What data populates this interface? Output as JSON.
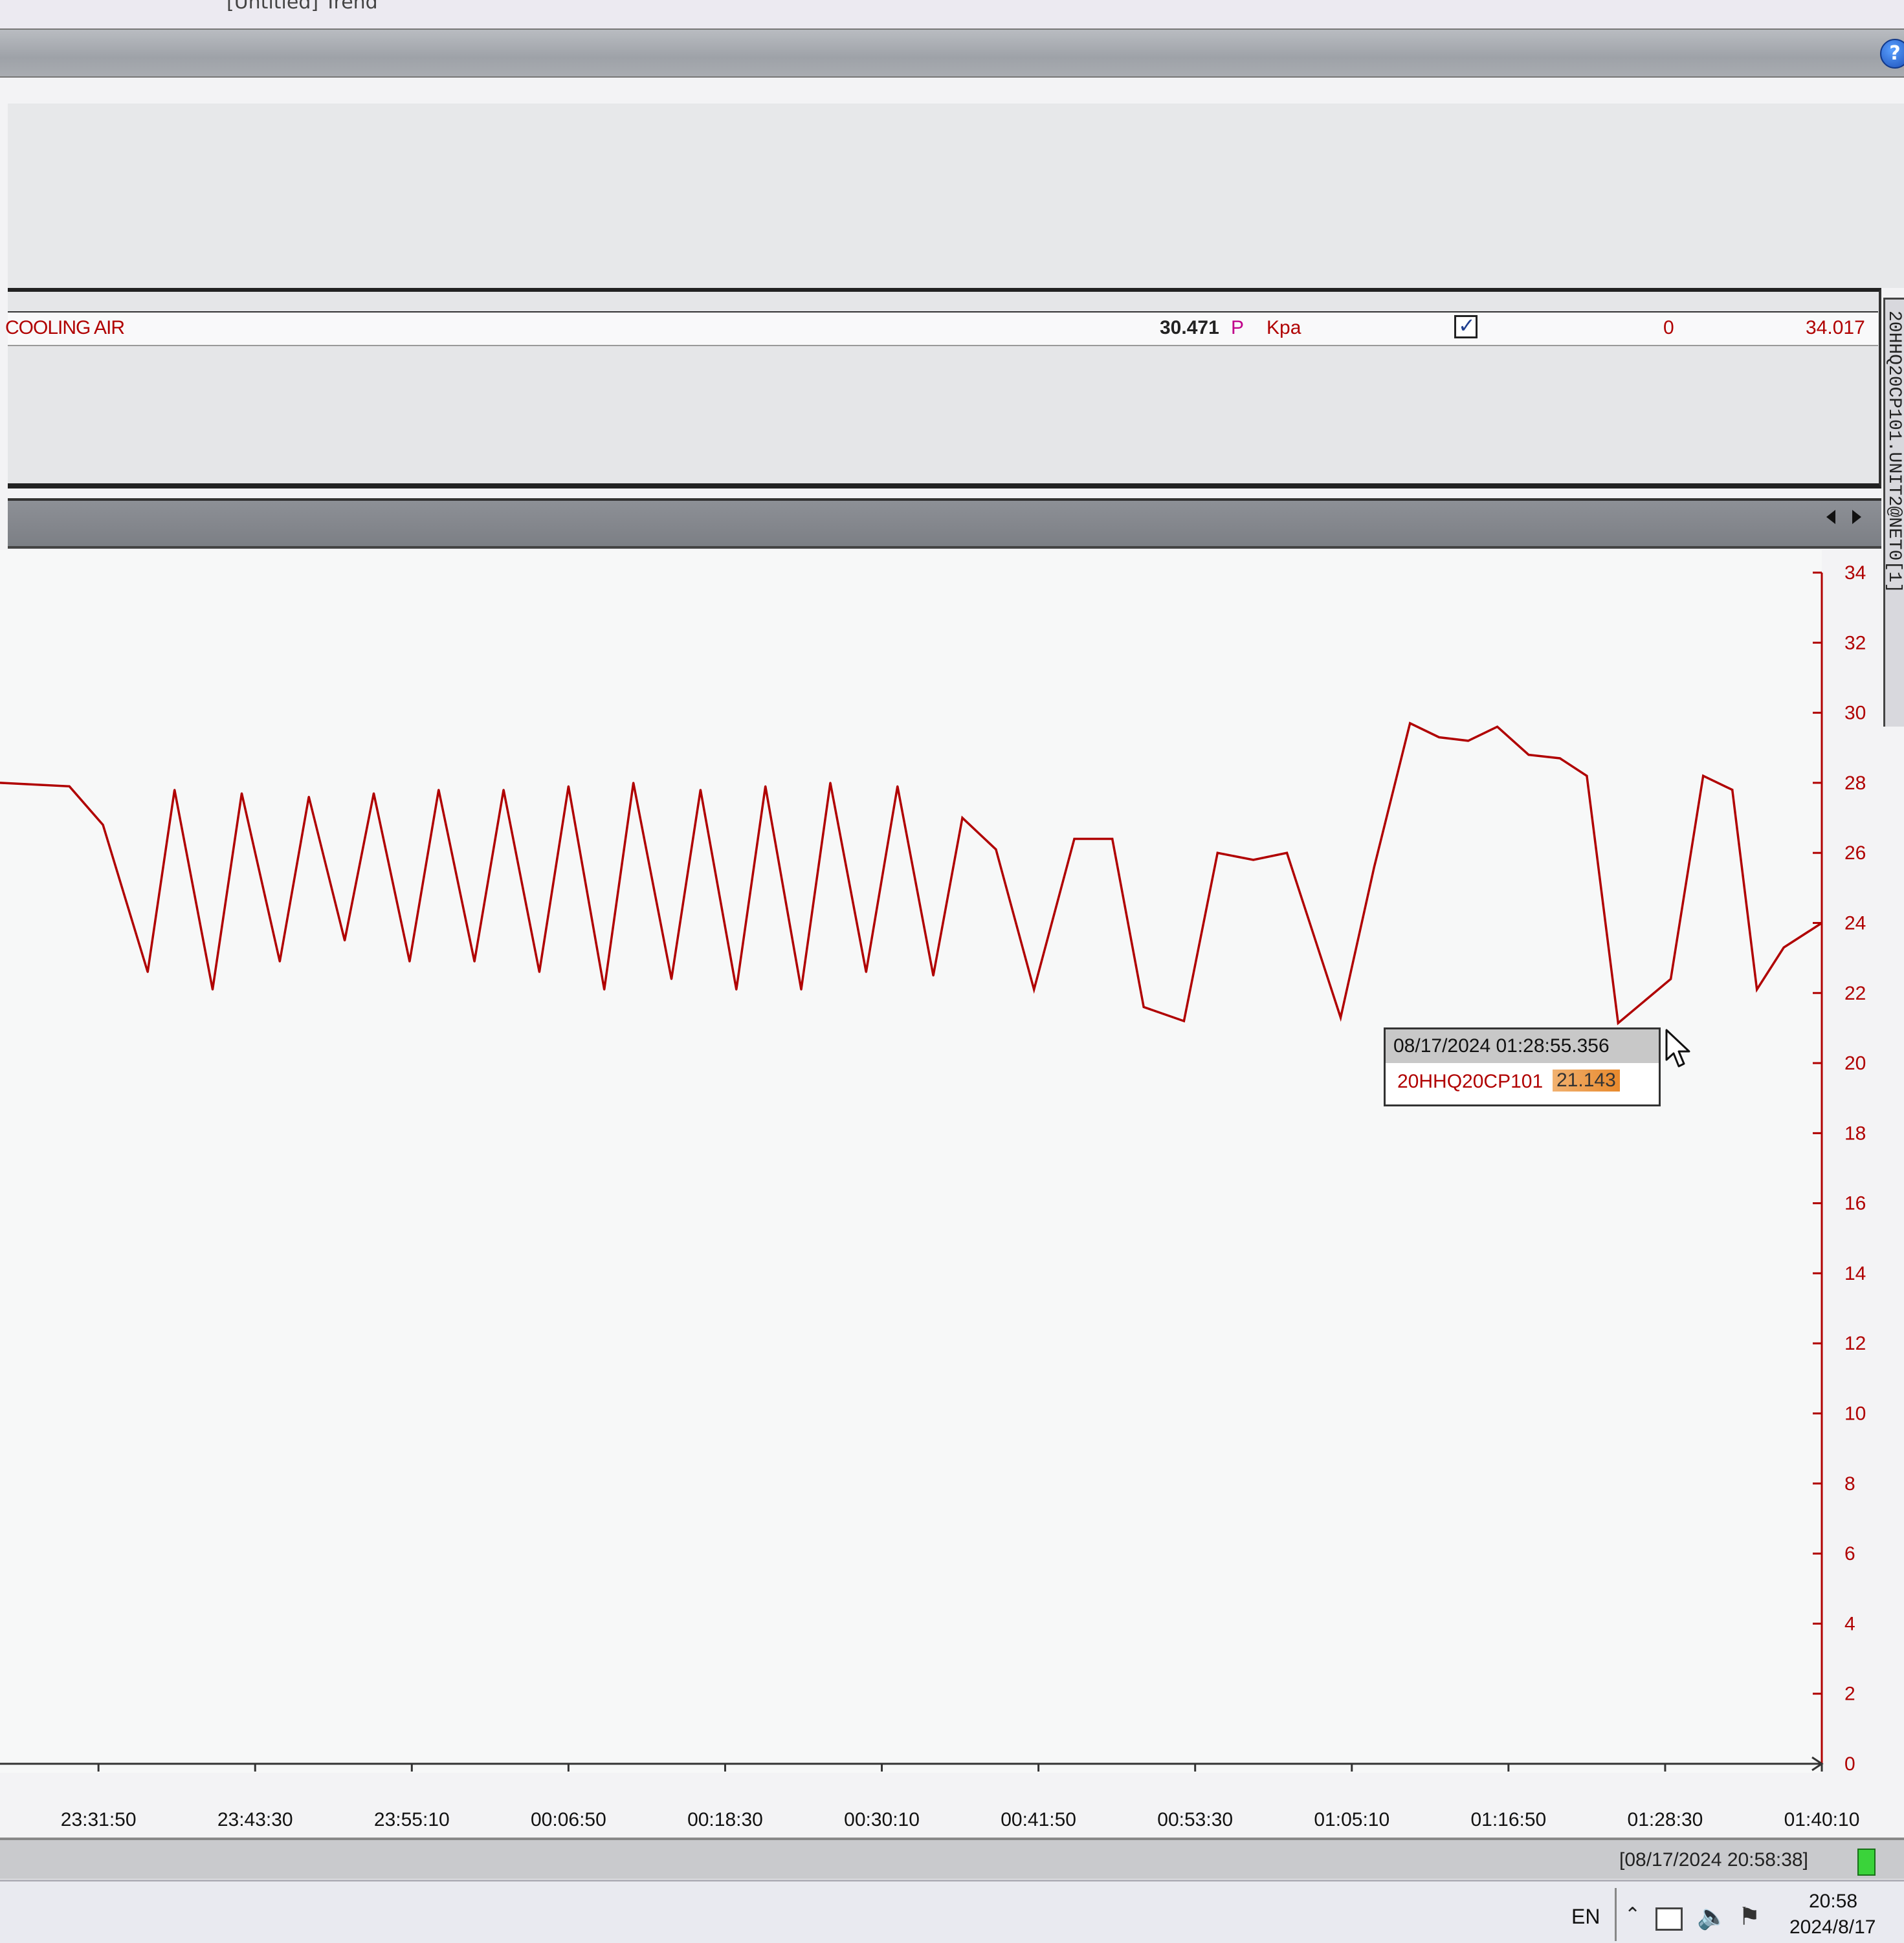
{
  "window": {
    "title": "[Untitled] Trend"
  },
  "series_row": {
    "name": "COOLING AIR",
    "current_value": "30.471",
    "quality": "P",
    "unit": "Kpa",
    "visible_checked": true,
    "min": "0",
    "max": "34.017"
  },
  "vertical_tab": {
    "label": "20HHQ20CP101.UNIT2@NET0[1]"
  },
  "tooltip": {
    "timestamp": "08/17/2024 01:28:55.356",
    "tag": "20HHQ20CP101",
    "value": "21.143"
  },
  "status_bar": {
    "timestamp": "[08/17/2024 20:58:38]"
  },
  "taskbar": {
    "language": "EN",
    "clock_time": "20:58",
    "clock_date": "2024/8/17"
  },
  "colors": {
    "series_line": "#b00000",
    "axis": "#b00000"
  },
  "chart_data": {
    "type": "line",
    "x_tick_labels": [
      "23:31:50",
      "23:43:30",
      "23:55:10",
      "00:06:50",
      "00:18:30",
      "00:30:10",
      "00:41:50",
      "00:53:30",
      "01:05:10",
      "01:16:50",
      "01:28:30",
      "01:40:10"
    ],
    "ylim": [
      0,
      34
    ],
    "y_ticks": [
      0,
      2,
      4,
      6,
      8,
      10,
      12,
      14,
      16,
      18,
      20,
      22,
      24,
      26,
      28,
      30,
      32,
      34
    ],
    "y_axis_position": "right",
    "xlim": [
      "23:24:30",
      "01:40:10"
    ],
    "series": [
      {
        "x": [
          "23:24:30",
          "23:29:40",
          "23:32:10",
          "23:35:30",
          "23:37:30",
          "23:40:20",
          "23:42:30",
          "23:45:20",
          "23:47:30",
          "23:50:10",
          "23:52:20",
          "23:55:00",
          "23:57:10",
          "23:59:50",
          "00:02:00",
          "00:04:40",
          "00:06:50",
          "00:09:30",
          "00:11:40",
          "00:14:30",
          "00:16:40",
          "00:19:20",
          "00:21:30",
          "00:24:10",
          "00:26:20",
          "00:29:00",
          "00:31:20",
          "00:34:00",
          "00:36:10",
          "00:38:40",
          "00:41:30",
          "00:44:30",
          "00:47:20",
          "00:49:40",
          "00:52:40",
          "00:55:10",
          "00:57:50",
          "01:00:20",
          "01:04:20",
          "01:06:50",
          "01:09:30",
          "01:11:40",
          "01:13:50",
          "01:16:00",
          "01:18:20",
          "01:20:40",
          "01:22:40",
          "01:25:00",
          "01:28:55",
          "01:31:20",
          "01:33:30",
          "01:35:20",
          "01:37:20",
          "01:40:10"
        ],
        "y": [
          28.0,
          27.9,
          26.8,
          22.6,
          27.8,
          22.1,
          27.7,
          22.9,
          27.6,
          23.5,
          27.7,
          22.9,
          27.8,
          22.9,
          27.8,
          22.6,
          27.9,
          22.1,
          28.0,
          22.4,
          27.8,
          22.1,
          27.9,
          22.1,
          28.0,
          22.6,
          27.9,
          22.5,
          27.0,
          26.1,
          22.1,
          26.4,
          26.4,
          21.6,
          21.2,
          26.0,
          25.8,
          26.0,
          21.3,
          25.6,
          29.7,
          29.3,
          29.2,
          29.6,
          28.8,
          28.7,
          28.2,
          21.143,
          22.4,
          28.2,
          27.8,
          22.1,
          23.3,
          24.0
        ]
      }
    ]
  }
}
